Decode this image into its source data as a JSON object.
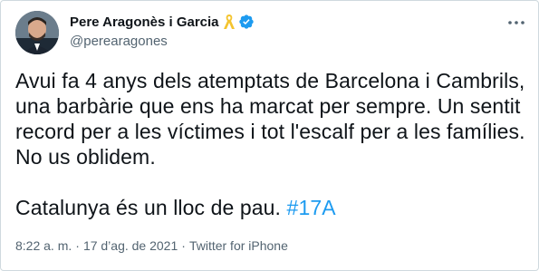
{
  "author": {
    "name": "Pere Aragonès i Garcia",
    "handle": "@perearagones",
    "ribbon_icon": "yellow-ribbon-icon",
    "verified_icon": "verified-badge-icon",
    "verified_color": "#1d9bf0",
    "ribbon_color": "#f4c430"
  },
  "tweet": {
    "lines": [
      "Avui fa 4 anys dels atemptats de Barcelona i Cambrils,",
      "una barbàrie que ens ha marcat per sempre. Un sentit",
      "record per a les víctimes i tot l'escalf per a les famílies.",
      "No us oblidem."
    ],
    "closing_text": "Catalunya és un lloc de pau. ",
    "hashtag": "#17A",
    "hashtag_color": "#1d9bf0"
  },
  "meta": {
    "time": "8:22 a. m.",
    "separator": "·",
    "date": "17 d’ag. de 2021",
    "source": "Twitter for iPhone"
  },
  "menu": {
    "icon": "more-options-icon"
  }
}
